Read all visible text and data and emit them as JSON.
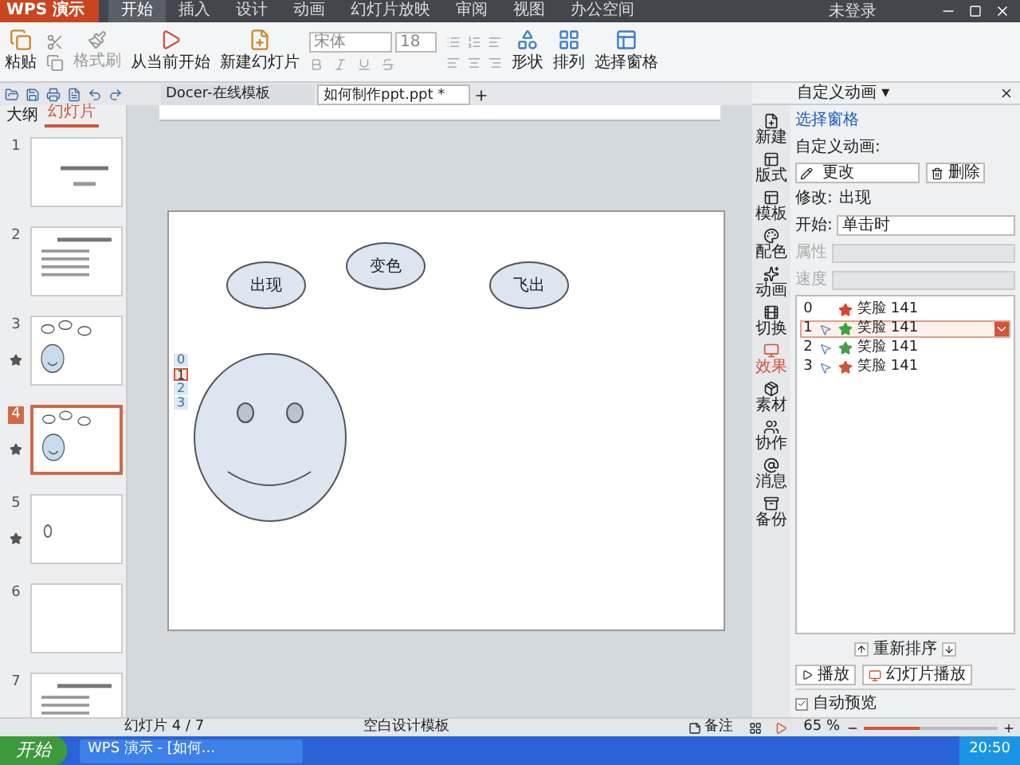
{
  "app_button": {
    "label": "WPS 演示"
  },
  "menu": [
    {
      "label": "开始",
      "selected": true
    },
    {
      "label": "插入",
      "selected": false
    },
    {
      "label": "设计",
      "selected": false
    },
    {
      "label": "动画",
      "selected": false
    },
    {
      "label": "幻灯片放映",
      "selected": false
    },
    {
      "label": "审阅",
      "selected": false
    },
    {
      "label": "视图",
      "selected": false
    },
    {
      "label": "办公空间",
      "selected": false
    }
  ],
  "account": {
    "label": "未登录"
  },
  "ribbon": {
    "paste": "粘贴",
    "format_painter": "格式刷",
    "from_current": "从当前开始",
    "new_slide": "新建幻灯片",
    "font": "宋体",
    "font_size": "18",
    "shape": "形状",
    "arrange": "排列",
    "selection_pane": "选择窗格"
  },
  "doc_tabs": [
    {
      "label": "Docer-在线模板",
      "selected": false
    },
    {
      "label": "如何制作ppt.ppt *",
      "selected": true
    }
  ],
  "left_panel": {
    "tabs": [
      {
        "label": "大纲",
        "selected": false
      },
      {
        "label": "幻灯片",
        "selected": true
      }
    ],
    "slides": [
      {
        "number": "1",
        "kind": "title",
        "selected": false,
        "animated": false
      },
      {
        "number": "2",
        "kind": "bullets",
        "selected": false,
        "animated": false
      },
      {
        "number": "3",
        "kind": "smiley",
        "selected": false,
        "animated": true
      },
      {
        "number": "4",
        "kind": "smiley",
        "selected": true,
        "animated": true
      },
      {
        "number": "5",
        "kind": "circle",
        "selected": false,
        "animated": true
      },
      {
        "number": "6",
        "kind": "blank",
        "selected": false,
        "animated": false
      },
      {
        "number": "7",
        "kind": "bullets",
        "selected": false,
        "animated": false
      }
    ]
  },
  "slide": {
    "shapes": [
      {
        "label": "出现"
      },
      {
        "label": "变色"
      },
      {
        "label": "飞出"
      }
    ],
    "tags": [
      {
        "label": "0",
        "selected": false
      },
      {
        "label": "1",
        "selected": true
      },
      {
        "label": "2",
        "selected": false
      },
      {
        "label": "3",
        "selected": false
      }
    ]
  },
  "side_strip": [
    {
      "label": "新建",
      "selected": false
    },
    {
      "label": "版式",
      "selected": false
    },
    {
      "label": "模板",
      "selected": false
    },
    {
      "label": "配色",
      "selected": false
    },
    {
      "label": "动画",
      "selected": false
    },
    {
      "label": "切换",
      "selected": false
    },
    {
      "label": "效果",
      "selected": true
    },
    {
      "label": "素材",
      "selected": false
    },
    {
      "label": "协作",
      "selected": false
    },
    {
      "label": "消息",
      "selected": false
    },
    {
      "label": "备份",
      "selected": false
    }
  ],
  "task_pane": {
    "title": "自定义动画 ▾",
    "selection_link": "选择窗格",
    "section": "自定义动画:",
    "change": "更改",
    "delete": "删除",
    "modify_label": "修改:",
    "modify_value": "出现",
    "start_label": "开始:",
    "start_value": "单击时",
    "property_label": "属性",
    "speed_label": "速度",
    "effects": [
      {
        "index": "0",
        "on_click": false,
        "color": "#d9452b",
        "name": "笑脸 141",
        "selected": false
      },
      {
        "index": "1",
        "on_click": true,
        "color": "#3aa53a",
        "name": "笑脸 141",
        "selected": true
      },
      {
        "index": "2",
        "on_click": true,
        "color": "#4a9a4a",
        "name": "笑脸 141",
        "selected": false
      },
      {
        "index": "3",
        "on_click": true,
        "color": "#d0553a",
        "name": "笑脸 141",
        "selected": false
      }
    ],
    "reorder": "重新排序",
    "play": "播放",
    "slideshow": "幻灯片播放",
    "auto_preview": {
      "label": "自动预览",
      "checked": true
    }
  },
  "status_bar": {
    "slide_count": "幻灯片 4 / 7",
    "template": "空白设计模板",
    "notes": "备注",
    "zoom": "65 %",
    "zoom_slider": {
      "level": 0.42
    }
  },
  "taskbar": {
    "start": "开始",
    "window": "WPS 演示 - [如何...",
    "time": "20:50"
  }
}
